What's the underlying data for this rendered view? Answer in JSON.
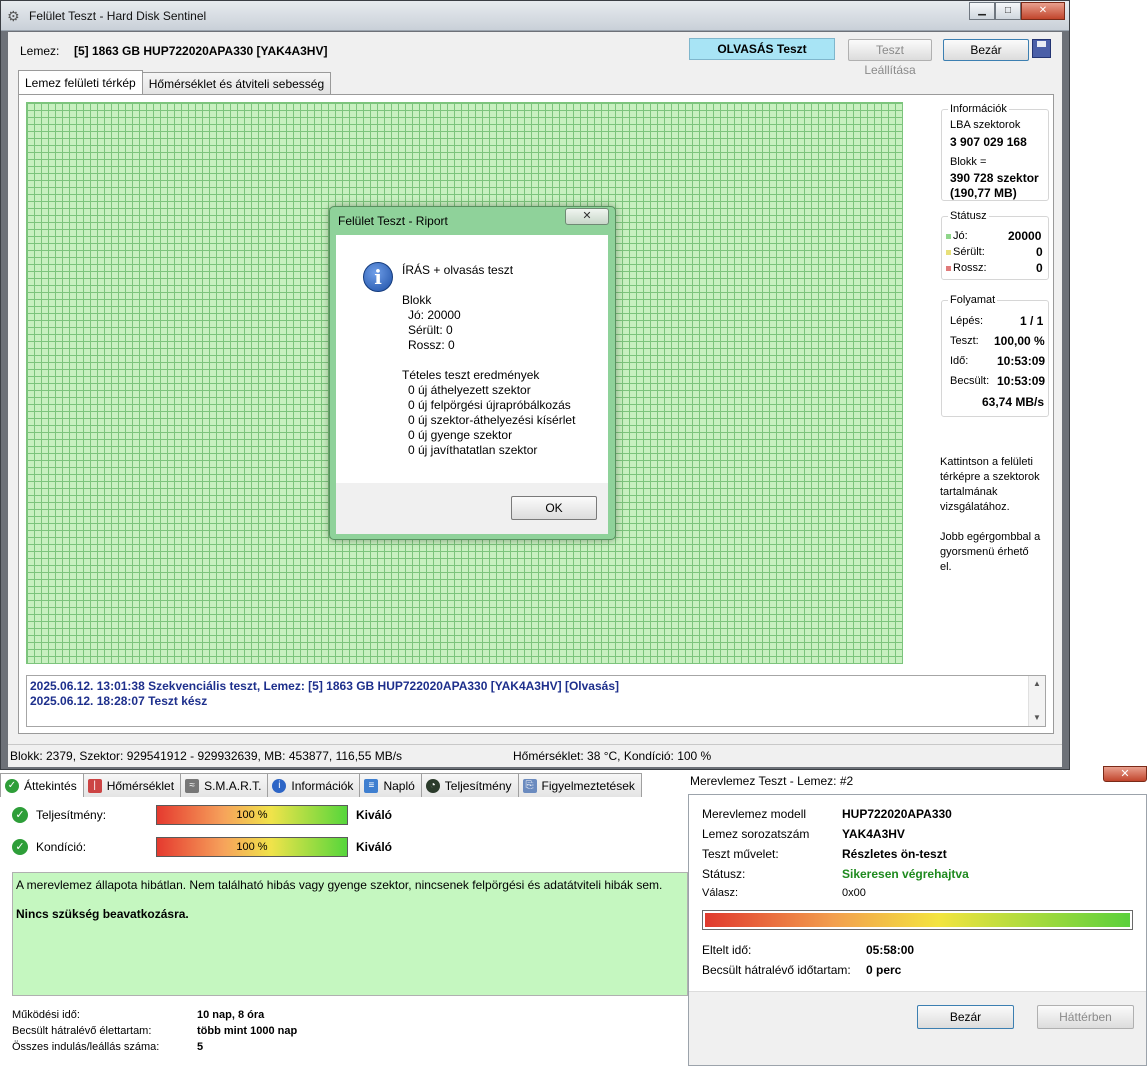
{
  "window": {
    "title": "Felület Teszt - Hard Disk Sentinel",
    "min": "▁",
    "max": "□",
    "close": "✕"
  },
  "topbar": {
    "disk_label": "Lemez:",
    "disk_value": "[5] 1863 GB  HUP722020APA330 [YAK4A3HV]",
    "mode": "OLVASÁS Teszt",
    "stop_btn": "Teszt Leállítása",
    "close_btn": "Bezár"
  },
  "tabs": [
    "Lemez felületi térkép",
    "Hőmérséklet és átviteli sebesség"
  ],
  "side": {
    "info_title": "Információk",
    "lba_label": "LBA szektorok",
    "lba_value": "3 907 029 168",
    "block_label": "Blokk =",
    "block_value1": "390 728 szektor",
    "block_value2": "(190,77 MB)",
    "status_title": "Státusz",
    "good_label": "Jó:",
    "good_value": "20000",
    "damaged_label": "Sérült:",
    "damaged_value": "0",
    "bad_label": "Rossz:",
    "bad_value": "0",
    "progress_title": "Folyamat",
    "step_label": "Lépés:",
    "step_value": "1 / 1",
    "test_label": "Teszt:",
    "test_value": "100,00 %",
    "time_label": "Idő:",
    "time_value": "10:53:09",
    "est_label": "Becsült:",
    "est_value": "10:53:09",
    "speed_value": "63,74 MB/s",
    "hint1": "Kattintson a felületi",
    "hint2": "térképre a szektorok",
    "hint3": "tartalmának",
    "hint4": "vizsgálatához.",
    "hint5": "Jobb egérgombbal a",
    "hint6": "gyorsmenü érhető",
    "hint7": "el.",
    "color_good": "#8fd68a",
    "color_damaged": "#e8e07a",
    "color_bad": "#e07a7a"
  },
  "log": {
    "line1": "2025.06.12.  13:01:38   Szekvenciális teszt, Lemez: [5] 1863 GB  HUP722020APA330 [YAK4A3HV] [Olvasás]",
    "line2": "2025.06.12.  18:28:07   Teszt kész"
  },
  "statusbar": {
    "left": "Blokk: 2379, Szektor: 929541912 - 929932639, MB: 453877, 116,55 MB/s",
    "right": "Hőmérséklet: 38  °C,  Kondíció: 100 %"
  },
  "report": {
    "title": "Felület Teszt - Riport",
    "close": "✕",
    "heading": "ÍRÁS + olvasás teszt",
    "block_title": "Blokk",
    "good": "Jó: 20000",
    "damaged": "Sérült: 0",
    "bad": "Rossz: 0",
    "results_title": "Tételes teszt eredmények",
    "r1": "0 új áthelyezett szektor",
    "r2": "0 új felpörgési újrapróbálkozás",
    "r3": "0 új szektor-áthelyezési kísérlet",
    "r4": "0 új gyenge szektor",
    "r5": "0 új javíthatatlan szektor",
    "ok": "OK"
  },
  "bottom_tabs": [
    "Áttekintés",
    "Hőmérséklet",
    "S.M.A.R.T.",
    "Információk",
    "Napló",
    "Teljesítmény",
    "Figyelmeztetések"
  ],
  "overview": {
    "perf_label": "Teljesítmény:",
    "perf_value": "100 %",
    "perf_level": 1.0,
    "perf_verdict": "Kiváló",
    "cond_label": "Kondíció:",
    "cond_value": "100 %",
    "cond_level": 1.0,
    "cond_verdict": "Kiváló",
    "summary1": "A merevlemez állapota hibátlan. Nem található hibás vagy gyenge szektor, nincsenek felpörgési és adatátviteli hibák sem.",
    "summary2": "Nincs szükség beavatkozásra.",
    "uptime_label": "Működési idő:",
    "uptime_value": "10 nap, 8 óra",
    "life_label": "Becsült hátralévő élettartam:",
    "life_value": "több mint 1000 nap",
    "starts_label": "Összes indulás/leállás száma:",
    "starts_value": "5"
  },
  "drive_test": {
    "title": "Merevlemez Teszt - Lemez: #2",
    "close": "✕",
    "model_label": "Merevlemez modell",
    "model_value": "HUP722020APA330",
    "serial_label": "Lemez sorozatszám",
    "serial_value": "YAK4A3HV",
    "op_label": "Teszt művelet:",
    "op_value": "Részletes ön-teszt",
    "status_label": "Státusz:",
    "status_value": "Sikeresen végrehajtva",
    "answer_label": "Válasz:",
    "answer_value": "0x00",
    "progress_level": 1.0,
    "elapsed_label": "Eltelt idő:",
    "elapsed_value": "05:58:00",
    "remaining_label": "Becsült hátralévő időtartam:",
    "remaining_value": "0 perc",
    "close_btn": "Bezár",
    "background_btn": "Háttérben",
    "status_color": "#1e8a1e"
  }
}
